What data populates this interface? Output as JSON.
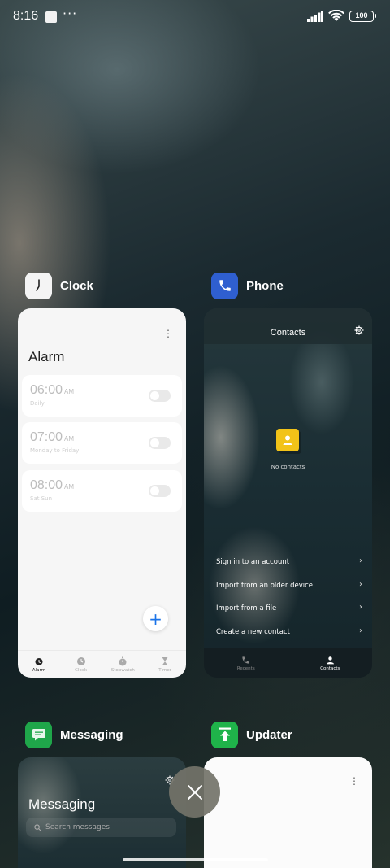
{
  "status_bar": {
    "time": "8:16",
    "more_indicator": "···",
    "battery": "100",
    "icons": [
      "signal-icon",
      "wifi-icon",
      "battery-icon"
    ]
  },
  "apps": [
    {
      "name": "Clock",
      "icon": "clock-icon",
      "screen": {
        "title": "Alarm",
        "alarms": [
          {
            "time": "06:00",
            "ampm": "AM",
            "repeat": "Daily",
            "enabled": false
          },
          {
            "time": "07:00",
            "ampm": "AM",
            "repeat": "Monday to Friday",
            "enabled": false
          },
          {
            "time": "08:00",
            "ampm": "AM",
            "repeat": "Sat Sun",
            "enabled": false
          }
        ],
        "add_button": "+",
        "nav": [
          "Alarm",
          "Clock",
          "Stopwatch",
          "Timer"
        ]
      }
    },
    {
      "name": "Phone",
      "icon": "phone-icon",
      "screen": {
        "title": "Contacts",
        "empty_text": "No contacts",
        "menu": [
          "Sign in to an account",
          "Import from an older device",
          "Import from a file",
          "Create a new contact"
        ],
        "nav": [
          "Recents",
          "Contacts"
        ]
      }
    },
    {
      "name": "Messaging",
      "icon": "messaging-icon",
      "screen": {
        "title": "Messaging",
        "search_placeholder": "Search messages"
      }
    },
    {
      "name": "Updater",
      "icon": "updater-icon",
      "screen": {}
    }
  ],
  "colors": {
    "phone_icon_bg": "#2f5fd0",
    "messaging_icon_bg": "#1fa64a",
    "updater_icon_bg": "#1fb34a",
    "contact_icon_bg": "#f2c318",
    "fab_plus": "#1a73e8"
  }
}
